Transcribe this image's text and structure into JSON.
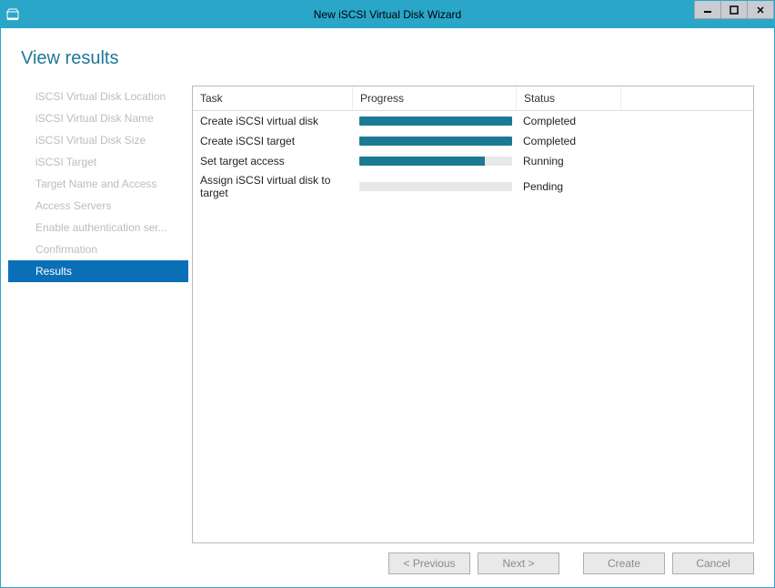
{
  "title": "New iSCSI Virtual Disk Wizard",
  "heading": "View results",
  "sidebar": {
    "items": [
      {
        "label": "iSCSI Virtual Disk Location"
      },
      {
        "label": "iSCSI Virtual Disk Name"
      },
      {
        "label": "iSCSI Virtual Disk Size"
      },
      {
        "label": "iSCSI Target"
      },
      {
        "label": "Target Name and Access"
      },
      {
        "label": "Access Servers"
      },
      {
        "label": "Enable authentication ser..."
      },
      {
        "label": "Confirmation"
      },
      {
        "label": "Results"
      }
    ],
    "active_index": 8
  },
  "results": {
    "headers": {
      "task": "Task",
      "progress": "Progress",
      "status": "Status"
    },
    "rows": [
      {
        "task": "Create iSCSI virtual disk",
        "progress_pct": 100,
        "status": "Completed"
      },
      {
        "task": "Create iSCSI target",
        "progress_pct": 100,
        "status": "Completed"
      },
      {
        "task": "Set target access",
        "progress_pct": 82,
        "status": "Running"
      },
      {
        "task": "Assign iSCSI virtual disk to target",
        "progress_pct": 0,
        "status": "Pending"
      }
    ]
  },
  "buttons": {
    "previous": "< Previous",
    "next": "Next >",
    "create": "Create",
    "close": "Cancel"
  }
}
